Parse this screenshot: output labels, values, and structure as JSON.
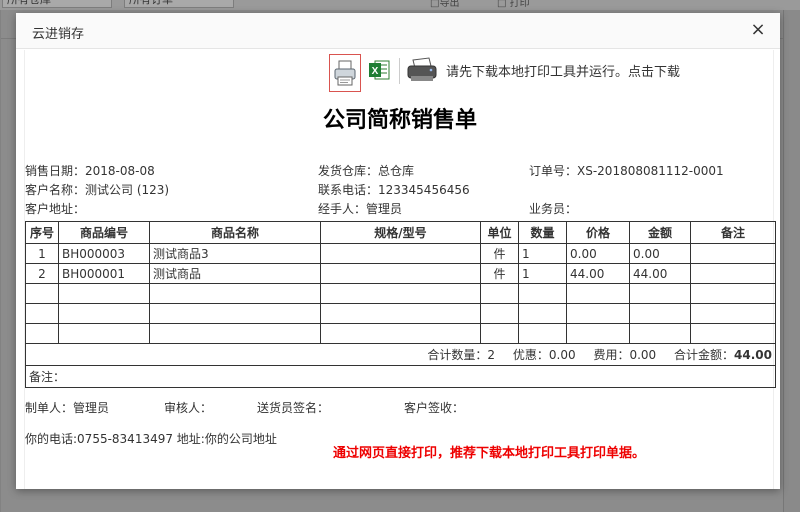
{
  "background": {
    "selects": [
      "所有仓库",
      "所有订单"
    ],
    "buttons": [
      "□导出",
      "□ 打印"
    ]
  },
  "dialog": {
    "title": "云进销存",
    "close_label": "×"
  },
  "toolbar": {
    "print_icon": "printer-preview-icon",
    "excel_icon": "excel-icon",
    "printer_icon": "printer-icon",
    "download_text": "请先下载本地打印工具并运行。点击下载"
  },
  "document": {
    "title": "公司简称销售单",
    "info": {
      "sale_date": "销售日期：2018-08-08",
      "warehouse": "发货仓库：总仓库",
      "order_no": "订单号：XS-201808081112-0001",
      "customer": "客户名称：测试公司 (123)",
      "phone": "联系电话：123345456456",
      "address": "客户地址：",
      "handler": "经手人：管理员",
      "salesman": "业务员："
    },
    "table": {
      "headers": [
        "序号",
        "商品编号",
        "商品名称",
        "规格/型号",
        "单位",
        "数量",
        "价格",
        "金额",
        "备注"
      ],
      "rows": [
        [
          "1",
          "BH000003",
          "测试商品3",
          "",
          "件",
          "1",
          "0.00",
          "0.00",
          ""
        ],
        [
          "2",
          "BH000001",
          "测试商品",
          "",
          "件",
          "1",
          "44.00",
          "44.00",
          ""
        ]
      ],
      "summary": {
        "qty": "合计数量：2",
        "discount": "优惠：0.00",
        "fee": "费用：0.00",
        "total_label": "合计金额：",
        "total_value": "44.00"
      },
      "remark": "备注："
    },
    "signatures": {
      "maker": "制单人：管理员",
      "auditor": "审核人：",
      "deliverer": "送货员签名：",
      "customer_sign": "客户签收："
    },
    "footer_contact": "你的电话:0755-83413497 地址:你的公司地址",
    "note": "通过网页直接打印，推荐下载本地打印工具打印单据。"
  }
}
